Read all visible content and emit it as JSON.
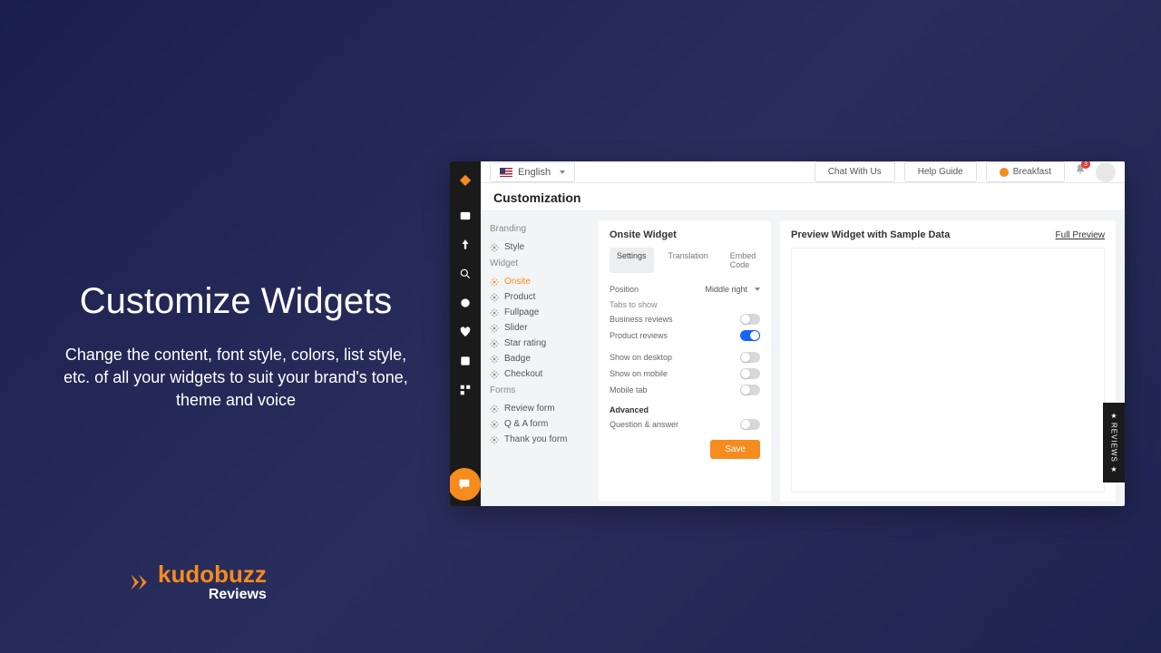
{
  "promo": {
    "title": "Customize Widgets",
    "desc": "Change the content, font style, colors, list style, etc. of all your widgets to suit your brand's tone, theme and voice"
  },
  "brand": {
    "name": "kudobuzz",
    "sub": "Reviews"
  },
  "topbar": {
    "language": "English",
    "chat": "Chat With Us",
    "help": "Help Guide",
    "breakfast": "Breakfast",
    "notif_count": "3"
  },
  "page": {
    "title": "Customization"
  },
  "sidebar": {
    "branding_label": "Branding",
    "style": "Style",
    "widget_label": "Widget",
    "widget_items": [
      {
        "label": "Onsite",
        "active": true
      },
      {
        "label": "Product"
      },
      {
        "label": "Fullpage"
      },
      {
        "label": "Slider"
      },
      {
        "label": "Star rating"
      },
      {
        "label": "Badge"
      },
      {
        "label": "Checkout"
      }
    ],
    "forms_label": "Forms",
    "form_items": [
      {
        "label": "Review form"
      },
      {
        "label": "Q & A form"
      },
      {
        "label": "Thank you form"
      }
    ]
  },
  "settings": {
    "card_title": "Onsite Widget",
    "tabs": [
      {
        "label": "Settings",
        "active": true
      },
      {
        "label": "Translation"
      },
      {
        "label": "Embed Code"
      }
    ],
    "position_label": "Position",
    "position_value": "Middle right",
    "tabs_to_show": "Tabs to show",
    "toggles": [
      {
        "label": "Business reviews",
        "on": false
      },
      {
        "label": "Product reviews",
        "on": true
      }
    ],
    "toggles2": [
      {
        "label": "Show on desktop",
        "on": false
      },
      {
        "label": "Show on mobile",
        "on": false
      },
      {
        "label": "Mobile tab",
        "on": false
      }
    ],
    "advanced": "Advanced",
    "toggles3": [
      {
        "label": "Question & answer",
        "on": false
      }
    ],
    "save": "Save"
  },
  "preview": {
    "title": "Preview Widget with Sample Data",
    "full": "Full Preview"
  },
  "reviews_tab": "REVIEWS"
}
